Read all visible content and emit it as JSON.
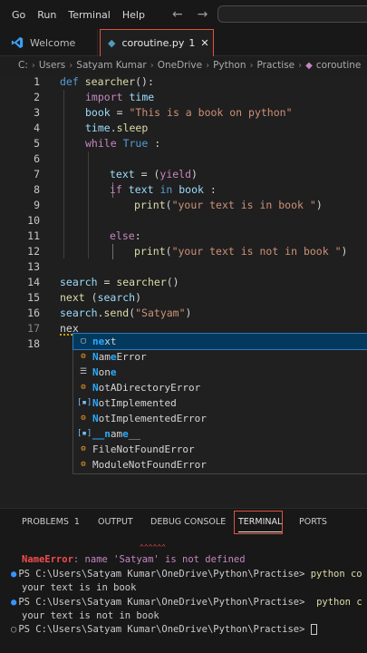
{
  "menu": [
    "Go",
    "Run",
    "Terminal",
    "Help"
  ],
  "tabs": {
    "welcome": "Welcome",
    "active_file": "coroutine.py",
    "active_badge": "1",
    "close": "✕"
  },
  "breadcrumb": [
    "C:",
    "Users",
    "Satyam Kumar",
    "OneDrive",
    "Python",
    "Practise",
    "coroutine"
  ],
  "code_lines": [
    {
      "n": "1",
      "html_key": "l1"
    },
    {
      "n": "2"
    },
    {
      "n": "3"
    },
    {
      "n": "4"
    },
    {
      "n": "5"
    },
    {
      "n": "6"
    },
    {
      "n": "7"
    },
    {
      "n": "8"
    },
    {
      "n": "9"
    },
    {
      "n": "10"
    },
    {
      "n": "11"
    },
    {
      "n": "12"
    },
    {
      "n": "13"
    },
    {
      "n": "14"
    },
    {
      "n": "15"
    },
    {
      "n": "16"
    },
    {
      "n": "17"
    },
    {
      "n": "18"
    }
  ],
  "code": {
    "l1": [
      "def",
      " ",
      "searcher",
      "():"
    ],
    "l2": [
      "import",
      " ",
      "time"
    ],
    "l3": [
      "book",
      " = ",
      "\"This is a book on python\""
    ],
    "l4": [
      "time",
      ".",
      "sleep"
    ],
    "l5": [
      "while",
      " ",
      "True",
      " :"
    ],
    "l7": [
      "text",
      " = (",
      "yield",
      ")"
    ],
    "l8": [
      "if",
      " ",
      "text",
      " ",
      "in",
      " ",
      "book",
      " :"
    ],
    "l9": [
      "print",
      "(",
      "\"your text is in book \"",
      ")"
    ],
    "l11": [
      "else",
      ":"
    ],
    "l12": [
      "print",
      "(",
      "\"your text is not in book \"",
      ")"
    ],
    "l14": [
      "search",
      " = ",
      "searcher",
      "()"
    ],
    "l15": [
      "next",
      " (",
      "search",
      ")"
    ],
    "l16": [
      "search",
      ".",
      "send",
      "(",
      "\"Satyam\"",
      ")"
    ],
    "l17": [
      "nex"
    ]
  },
  "suggestions": [
    {
      "match": "ne",
      "rest": "xt",
      "kind": "kw"
    },
    {
      "match": "N",
      "rest": "am",
      "match2": "e",
      "rest2": "Error",
      "kind": "cls"
    },
    {
      "match": "N",
      "rest": "on",
      "match2": "e",
      "rest2": "",
      "kind": "kw"
    },
    {
      "match": "N",
      "rest": "otADirectoryError",
      "kind": "cls"
    },
    {
      "match": "N",
      "rest": "otImplemented",
      "kind": "var"
    },
    {
      "match": "N",
      "rest": "otImplementedError",
      "kind": "cls"
    },
    {
      "match": "__n",
      "rest": "am",
      "match2": "e",
      "rest2": "__",
      "kind": "var"
    },
    {
      "match": "",
      "rest": "FileNotFoundError",
      "kind": "cls"
    },
    {
      "match": "",
      "rest": "ModuleNotFoundError",
      "kind": "cls"
    }
  ],
  "suggestion_labels": [
    "next",
    "NameError",
    "None",
    "NotADirectoryError",
    "NotImplemented",
    "NotImplementedError",
    "__name__",
    "FileNotFoundError",
    "ModuleNotFoundError"
  ],
  "panel": {
    "problems": "PROBLEMS",
    "problems_count": "1",
    "output": "OUTPUT",
    "debug": "DEBUG CONSOLE",
    "terminal": "TERMINAL",
    "ports": "PORTS"
  },
  "terminal": {
    "carets": "^^^^^^",
    "error_name": "NameError",
    "error_msg": ": name 'Satyam' is not defined",
    "prompt1": "PS C:\\Users\\Satyam Kumar\\OneDrive\\Python\\Practise> ",
    "cmd1": "python co",
    "out1": "your text is in book",
    "prompt2": "PS C:\\Users\\Satyam Kumar\\OneDrive\\Python\\Practise>  ",
    "cmd2": "python c",
    "out2": "your text is not in book",
    "prompt3": "PS C:\\Users\\Satyam Kumar\\OneDrive\\Python\\Practise> "
  },
  "colors": {
    "accent_outline": "#e0523d",
    "keyword": "#c586c0",
    "function": "#dcdcaa",
    "string": "#ce9178",
    "variable": "#9cdcfe",
    "constant": "#569cd6",
    "match": "#2aaaff"
  },
  "icons": {
    "welcome": "vscode-icon",
    "file": "python-icon",
    "class": "class-icon",
    "variable": "variable-icon",
    "keyword": "keyword-icon"
  }
}
